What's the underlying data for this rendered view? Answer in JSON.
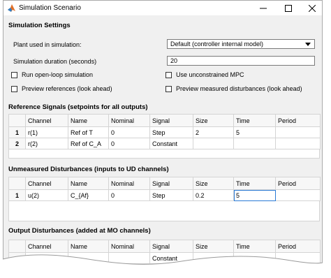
{
  "window": {
    "title": "Simulation Scenario",
    "minimize_icon": "minimize-icon",
    "maximize_icon": "maximize-icon",
    "close_icon": "close-icon"
  },
  "settings": {
    "heading": "Simulation Settings",
    "plant_label": "Plant used in simulation:",
    "plant_value": "Default (controller internal model)",
    "duration_label": "Simulation duration (seconds)",
    "duration_value": "20",
    "open_loop_label": "Run open-loop simulation",
    "unconstrained_label": "Use unconstrained MPC",
    "preview_refs_label": "Preview references (look ahead)",
    "preview_md_label": "Preview measured disturbances (look ahead)"
  },
  "columns": [
    "",
    "Channel",
    "Name",
    "Nominal",
    "Signal",
    "Size",
    "Time",
    "Period"
  ],
  "reference": {
    "heading": "Reference Signals (setpoints for all outputs)",
    "rows": [
      [
        "1",
        "r(1)",
        "Ref of T",
        "0",
        "Step",
        "2",
        "5",
        ""
      ],
      [
        "2",
        "r(2)",
        "Ref of C_A",
        "0",
        "Constant",
        "",
        "",
        ""
      ]
    ]
  },
  "unmeasured": {
    "heading": "Unmeasured Disturbances (inputs to UD channels)",
    "rows": [
      [
        "1",
        "u(2)",
        "C_{Af}",
        "0",
        "Step",
        "0.2",
        "5",
        ""
      ]
    ]
  },
  "output": {
    "heading": "Output Disturbances (added at MO channels)",
    "rows": [
      [
        "",
        "",
        "",
        "",
        "Constant",
        "",
        "",
        ""
      ]
    ]
  }
}
